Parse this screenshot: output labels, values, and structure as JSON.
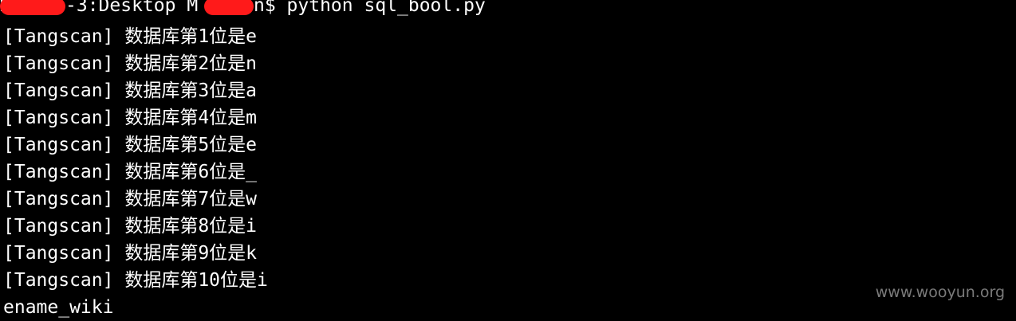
{
  "terminal": {
    "prompt": {
      "user_fragment_left": "M",
      "host_fragment": "-3:Desktop M",
      "command_fragment": "n$ python sql_bool.py"
    },
    "output_lines": [
      "[Tangscan] 数据库第1位是e",
      "[Tangscan] 数据库第2位是n",
      "[Tangscan] 数据库第3位是a",
      "[Tangscan] 数据库第4位是m",
      "[Tangscan] 数据库第5位是e",
      "[Tangscan] 数据库第6位是_",
      "[Tangscan] 数据库第7位是w",
      "[Tangscan] 数据库第8位是i",
      "[Tangscan] 数据库第9位是k",
      "[Tangscan] 数据库第10位是i"
    ],
    "result": "ename_wiki",
    "background_color": "#000000",
    "text_color": "#ffffff",
    "redaction_color": "#ff1a1a"
  },
  "watermark": {
    "text": "www.wooyun.org"
  }
}
